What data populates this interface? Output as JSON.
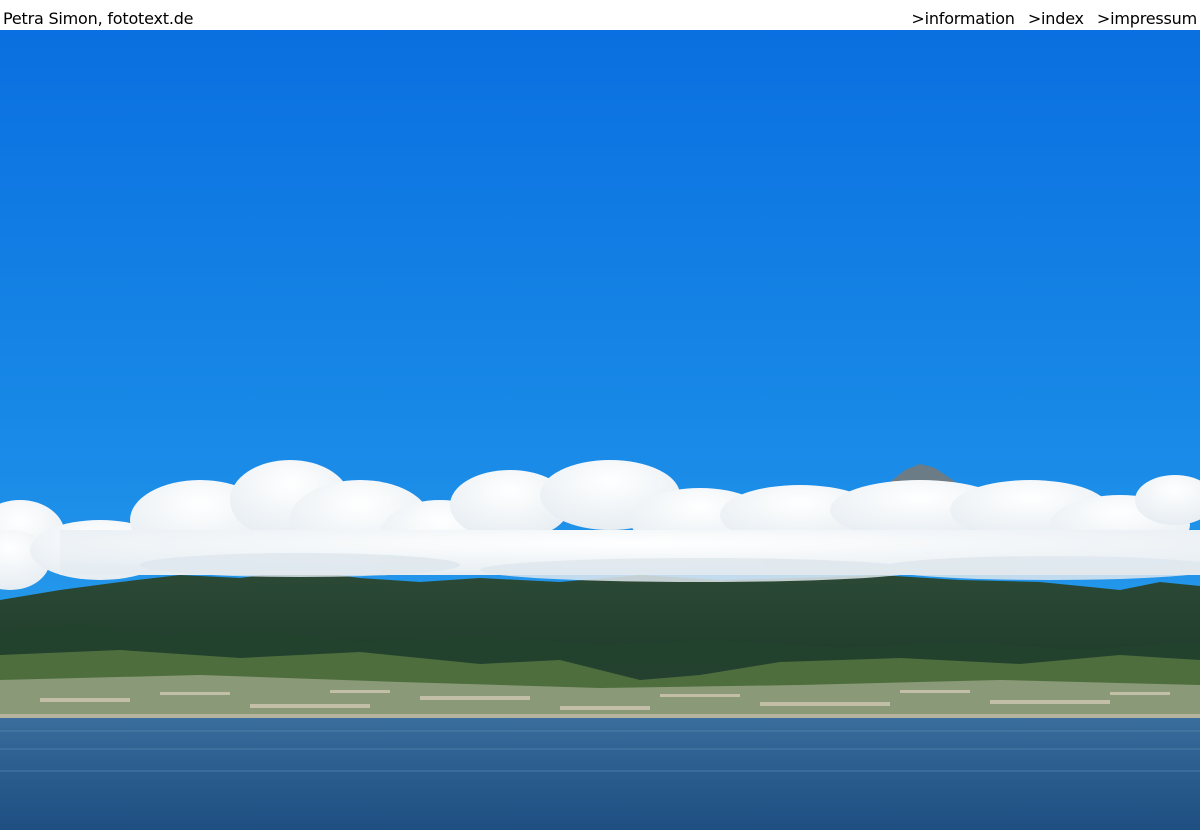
{
  "header": {
    "site_title": "Petra Simon, fototext.de",
    "nav": [
      {
        "label": ">information"
      },
      {
        "label": ">index"
      },
      {
        "label": ">impressum"
      }
    ]
  },
  "photo": {
    "subject": "",
    "colors": {
      "sky_top": "#0a6fe0",
      "sky_bottom": "#2fa6ec",
      "cloud": "#ffffff",
      "mountain": "#1f3a2a",
      "town": "#7d8f6a",
      "water": "#2b5d8f"
    }
  }
}
